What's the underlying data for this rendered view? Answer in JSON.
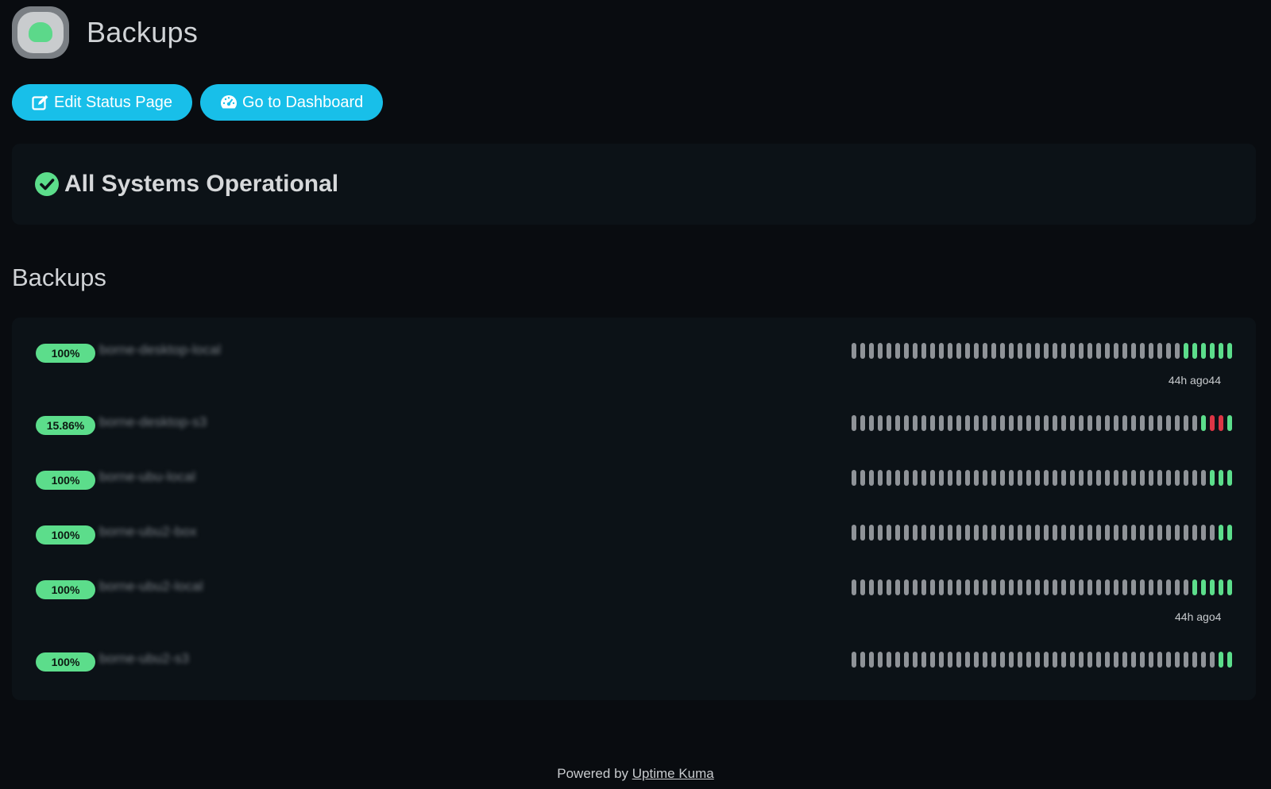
{
  "header": {
    "title": "Backups",
    "logo_icon": "uptime-kuma-logo-icon"
  },
  "toolbar": {
    "edit_label": "Edit Status Page",
    "edit_icon": "edit-icon",
    "dashboard_label": "Go to Dashboard",
    "dashboard_icon": "dashboard-gauge-icon"
  },
  "overall": {
    "text": "All Systems Operational",
    "icon": "check-circle-icon",
    "color": "#5cdd8b"
  },
  "group": {
    "title": "Backups",
    "monitors": [
      {
        "uptime": "100%",
        "name": "borne-desktop-local",
        "ago": "44h ago44",
        "beats": [
          "empty",
          "empty",
          "empty",
          "empty",
          "empty",
          "empty",
          "empty",
          "empty",
          "empty",
          "empty",
          "empty",
          "empty",
          "empty",
          "empty",
          "empty",
          "empty",
          "empty",
          "empty",
          "empty",
          "empty",
          "empty",
          "empty",
          "empty",
          "empty",
          "empty",
          "empty",
          "empty",
          "empty",
          "empty",
          "empty",
          "empty",
          "empty",
          "empty",
          "empty",
          "empty",
          "empty",
          "empty",
          "empty",
          "up",
          "up",
          "up",
          "up",
          "up",
          "up"
        ]
      },
      {
        "uptime": "15.86%",
        "name": "borne-desktop-s3",
        "ago": "",
        "beats": [
          "empty",
          "empty",
          "empty",
          "empty",
          "empty",
          "empty",
          "empty",
          "empty",
          "empty",
          "empty",
          "empty",
          "empty",
          "empty",
          "empty",
          "empty",
          "empty",
          "empty",
          "empty",
          "empty",
          "empty",
          "empty",
          "empty",
          "empty",
          "empty",
          "empty",
          "empty",
          "empty",
          "empty",
          "empty",
          "empty",
          "empty",
          "empty",
          "empty",
          "empty",
          "empty",
          "empty",
          "empty",
          "empty",
          "empty",
          "empty",
          "up",
          "down",
          "down",
          "up"
        ]
      },
      {
        "uptime": "100%",
        "name": "borne-ubu-local",
        "ago": "",
        "beats": [
          "empty",
          "empty",
          "empty",
          "empty",
          "empty",
          "empty",
          "empty",
          "empty",
          "empty",
          "empty",
          "empty",
          "empty",
          "empty",
          "empty",
          "empty",
          "empty",
          "empty",
          "empty",
          "empty",
          "empty",
          "empty",
          "empty",
          "empty",
          "empty",
          "empty",
          "empty",
          "empty",
          "empty",
          "empty",
          "empty",
          "empty",
          "empty",
          "empty",
          "empty",
          "empty",
          "empty",
          "empty",
          "empty",
          "empty",
          "empty",
          "empty",
          "up",
          "up",
          "up"
        ]
      },
      {
        "uptime": "100%",
        "name": "borne-ubu2-box",
        "ago": "",
        "beats": [
          "empty",
          "empty",
          "empty",
          "empty",
          "empty",
          "empty",
          "empty",
          "empty",
          "empty",
          "empty",
          "empty",
          "empty",
          "empty",
          "empty",
          "empty",
          "empty",
          "empty",
          "empty",
          "empty",
          "empty",
          "empty",
          "empty",
          "empty",
          "empty",
          "empty",
          "empty",
          "empty",
          "empty",
          "empty",
          "empty",
          "empty",
          "empty",
          "empty",
          "empty",
          "empty",
          "empty",
          "empty",
          "empty",
          "empty",
          "empty",
          "empty",
          "empty",
          "up",
          "up"
        ]
      },
      {
        "uptime": "100%",
        "name": "borne-ubu2-local",
        "ago": "44h ago4",
        "beats": [
          "empty",
          "empty",
          "empty",
          "empty",
          "empty",
          "empty",
          "empty",
          "empty",
          "empty",
          "empty",
          "empty",
          "empty",
          "empty",
          "empty",
          "empty",
          "empty",
          "empty",
          "empty",
          "empty",
          "empty",
          "empty",
          "empty",
          "empty",
          "empty",
          "empty",
          "empty",
          "empty",
          "empty",
          "empty",
          "empty",
          "empty",
          "empty",
          "empty",
          "empty",
          "empty",
          "empty",
          "empty",
          "empty",
          "empty",
          "up",
          "up",
          "up",
          "up",
          "up"
        ]
      },
      {
        "uptime": "100%",
        "name": "borne-ubu2-s3",
        "ago": "",
        "beats": [
          "empty",
          "empty",
          "empty",
          "empty",
          "empty",
          "empty",
          "empty",
          "empty",
          "empty",
          "empty",
          "empty",
          "empty",
          "empty",
          "empty",
          "empty",
          "empty",
          "empty",
          "empty",
          "empty",
          "empty",
          "empty",
          "empty",
          "empty",
          "empty",
          "empty",
          "empty",
          "empty",
          "empty",
          "empty",
          "empty",
          "empty",
          "empty",
          "empty",
          "empty",
          "empty",
          "empty",
          "empty",
          "empty",
          "empty",
          "empty",
          "empty",
          "empty",
          "up",
          "up"
        ]
      }
    ]
  },
  "footer": {
    "prefix": "Powered by ",
    "link_text": "Uptime Kuma"
  },
  "colors": {
    "accent": "#18bfe9",
    "up": "#5cdd8b",
    "down": "#dc3545",
    "empty": "#8f9398"
  }
}
